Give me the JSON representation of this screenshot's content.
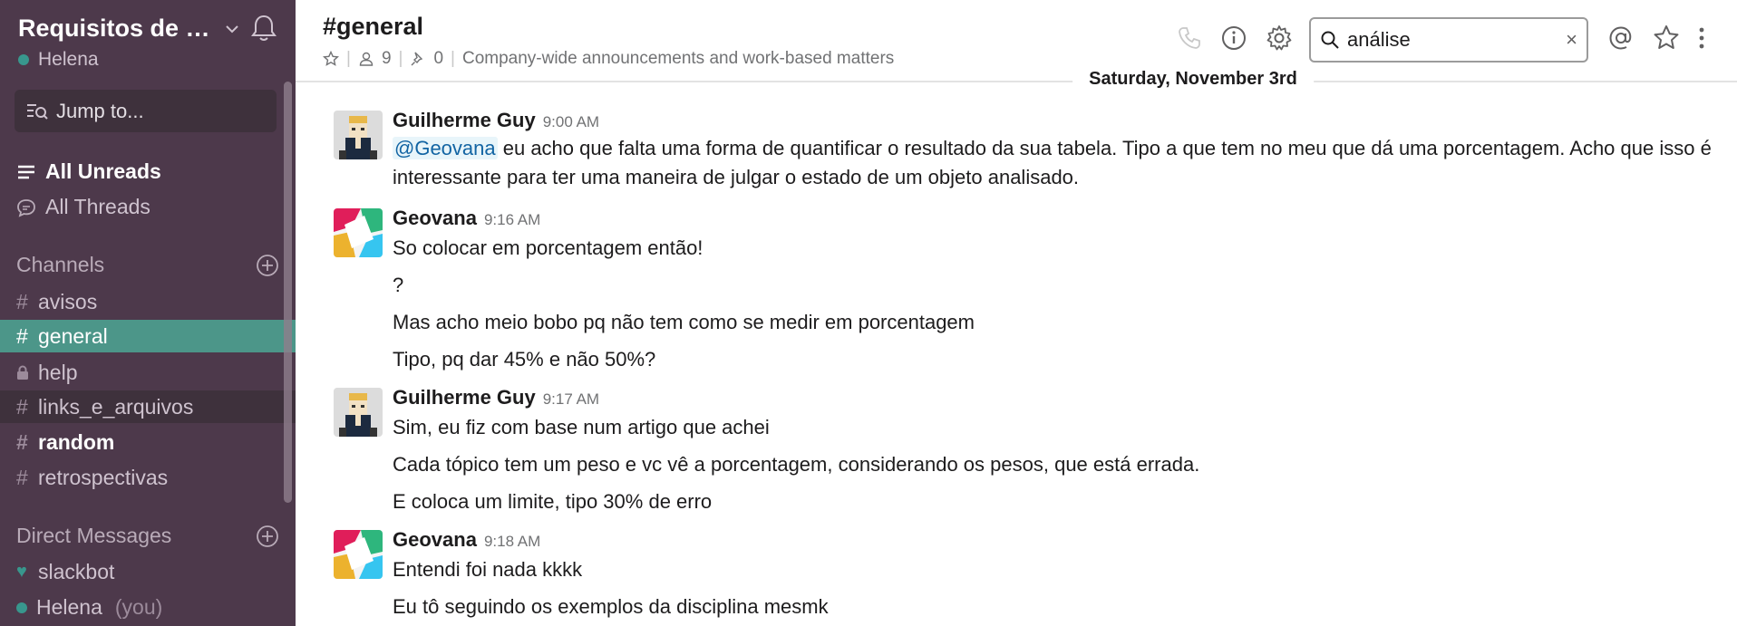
{
  "sidebar": {
    "workspace_name": "Requisitos de S...",
    "user_name": "Helena",
    "jump_label": "Jump to...",
    "all_unreads": "All Unreads",
    "all_threads": "All Threads",
    "channels_header": "Channels",
    "channels": [
      {
        "name": "avisos"
      },
      {
        "name": "general"
      },
      {
        "name": "help"
      },
      {
        "name": "links_e_arquivos"
      },
      {
        "name": "random"
      },
      {
        "name": "retrospectivas"
      }
    ],
    "dm_header": "Direct Messages",
    "dms": [
      {
        "name": "slackbot"
      },
      {
        "name": "Helena",
        "suffix": "(you)"
      }
    ]
  },
  "header": {
    "channel_title": "#general",
    "member_count": "9",
    "pinned_count": "0",
    "topic": "Company-wide announcements and work-based matters",
    "search_value": "análise",
    "clear_symbol": "×"
  },
  "date_divider": "Saturday, November 3rd",
  "messages": [
    {
      "author": "Guilherme Guy",
      "time": "9:00 AM",
      "mention": "@Geovana",
      "lines": [
        " eu acho que falta uma forma de quantificar o resultado da sua tabela. Tipo a que tem no meu que dá uma porcentagem. Acho que isso é interessante para ter uma maneira de julgar o estado de um objeto analisado."
      ]
    },
    {
      "author": "Geovana",
      "time": "9:16 AM",
      "lines": [
        "So colocar em porcentagem então!",
        "?",
        "Mas acho meio bobo pq não tem como se medir em porcentagem",
        "Tipo, pq dar 45% e não 50%?"
      ]
    },
    {
      "author": "Guilherme Guy",
      "time": "9:17 AM",
      "lines": [
        "Sim, eu fiz com base num artigo que achei",
        "Cada tópico tem um peso e vc vê a porcentagem, considerando os pesos, que está errada.",
        "E coloca um limite, tipo 30% de erro"
      ]
    },
    {
      "author": "Geovana",
      "time": "9:18 AM",
      "lines": [
        "Entendi foi nada kkkk",
        "Eu tô seguindo os exemplos da disciplina mesmk"
      ]
    }
  ],
  "colors": {
    "sidebar_bg": "#4d394b",
    "active_channel": "#4c9689",
    "presence_green": "#38978d",
    "mention_blue": "#1264a3"
  },
  "icons": [
    "chevron-down-icon",
    "bell-icon",
    "jump-icon",
    "unreads-icon",
    "threads-icon",
    "add-icon",
    "lock-icon",
    "heart-icon",
    "star-icon",
    "members-icon",
    "pin-icon",
    "phone-icon",
    "info-icon",
    "gear-icon",
    "search-icon",
    "at-icon",
    "kebab-icon"
  ]
}
